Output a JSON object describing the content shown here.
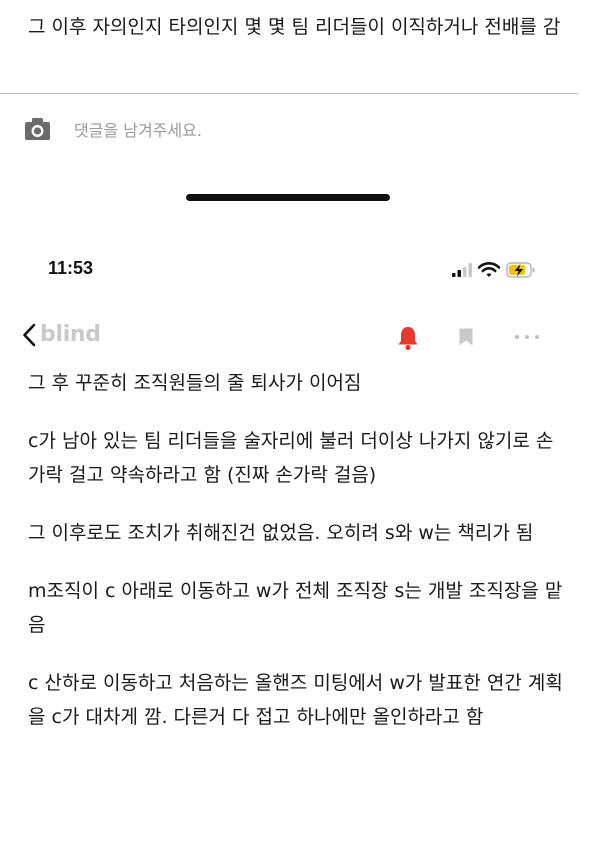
{
  "previous_post": {
    "text": "그 이후 자의인지 타의인지 몇 몇 팀 리더들이 이직하거나 전배를 감"
  },
  "comment": {
    "placeholder": "댓글을 남겨주세요."
  },
  "status_bar": {
    "time": "11:53"
  },
  "nav": {
    "brand": "blind"
  },
  "colors": {
    "bell": "#e5382e",
    "placeholder": "#9a9a9a",
    "brand": "#c9c9c9",
    "battery": "#f5c400"
  },
  "icons": [
    "camera-icon",
    "chevron-left-icon",
    "bell-icon",
    "bookmark-icon",
    "more-icon",
    "signal-icon",
    "wifi-icon",
    "battery-icon"
  ],
  "post": {
    "paragraphs": [
      "그 후 꾸준히 조직원들의 줄 퇴사가 이어짐",
      "c가 남아 있는 팀 리더들을 술자리에 불러 더이상 나가지 않기로 손가락 걸고 약속하라고 함 (진짜 손가락 걸음)",
      "그 이후로도 조치가 취해진건 없었음. 오히려 s와 w는 책리가 됨",
      "m조직이 c 아래로 이동하고 w가 전체 조직장 s는 개발 조직장을 맡음",
      "c 산하로 이동하고 처음하는 올핸즈 미팅에서 w가 발표한 연간 계획을 c가 대차게 깜. 다른거 다 접고 하나에만 올인하라고 함"
    ]
  }
}
